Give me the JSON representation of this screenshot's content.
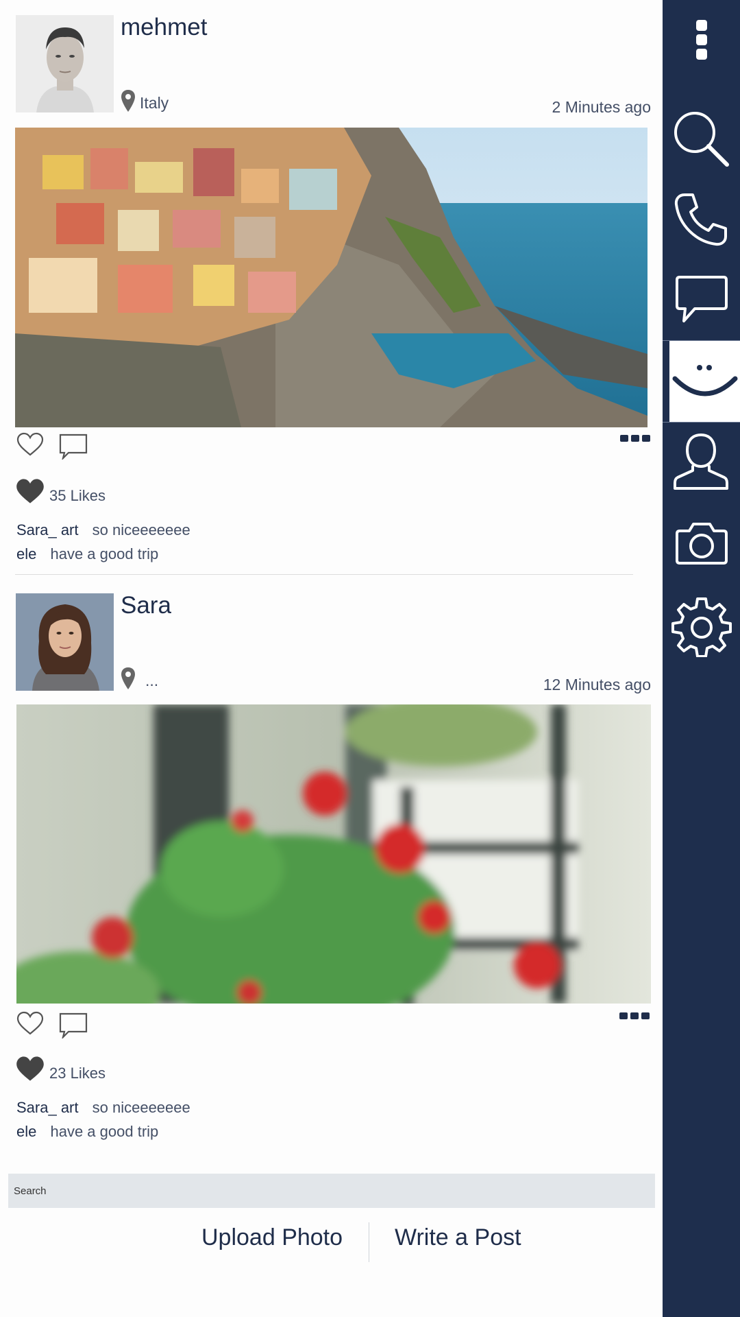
{
  "posts": [
    {
      "username": "mehmet",
      "location": "Italy",
      "time": "2 Minutes ago",
      "likes": "35 Likes",
      "comments": [
        {
          "user": "Sara_ art",
          "text": "so niceeeeeee"
        },
        {
          "user": "ele",
          "text": "have a good trip"
        }
      ]
    },
    {
      "username": "Sara",
      "location": "...",
      "time": "12 Minutes ago",
      "likes": "23 Likes",
      "comments": [
        {
          "user": "Sara_ art",
          "text": "so niceeeeeee"
        },
        {
          "user": "ele",
          "text": "have a good trip"
        }
      ]
    }
  ],
  "search": {
    "placeholder": "Search"
  },
  "actions": {
    "upload": "Upload Photo",
    "write": "Write a Post"
  },
  "sidebar": {
    "icons": [
      "more-vertical-icon",
      "search-icon",
      "phone-icon",
      "chat-icon",
      "smiley-icon",
      "profile-icon",
      "camera-icon",
      "settings-icon"
    ],
    "active": "smiley-icon"
  },
  "colors": {
    "sidebar": "#1e2e4d",
    "accent_text": "#1f2d4a",
    "search_bg": "#e2e6ea"
  }
}
